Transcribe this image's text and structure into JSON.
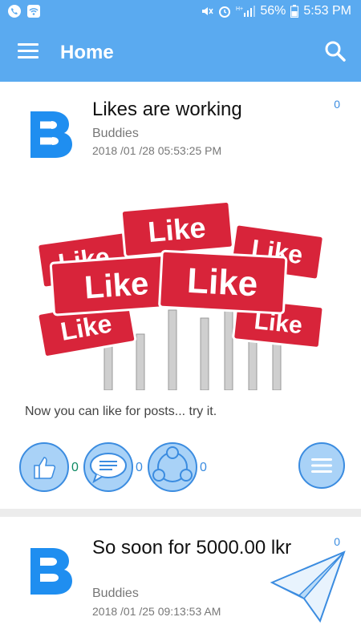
{
  "status_bar": {
    "battery": "56%",
    "time": "5:53 PM"
  },
  "app_bar": {
    "title": "Home"
  },
  "posts": [
    {
      "title": "Likes are working",
      "author": "Buddies",
      "date": "2018 /01 /28 05:53:25 PM",
      "badge_count": "0",
      "image_signs": [
        "Like",
        "Like",
        "Like",
        "Like",
        "Like",
        "Like",
        "Like"
      ],
      "text": "Now you can like for posts... try it.",
      "likes": "0",
      "comments": "0",
      "shares": "0"
    },
    {
      "title": "So soon for 5000.00 lkr",
      "author": "Buddies",
      "date": "2018 /01 /25 09:13:53 AM",
      "badge_count": "0"
    }
  ],
  "colors": {
    "primary": "#5aaaf0",
    "accent": "#3b8ce0",
    "like_count": "#0e8a63",
    "sign_red": "#d8243a"
  }
}
